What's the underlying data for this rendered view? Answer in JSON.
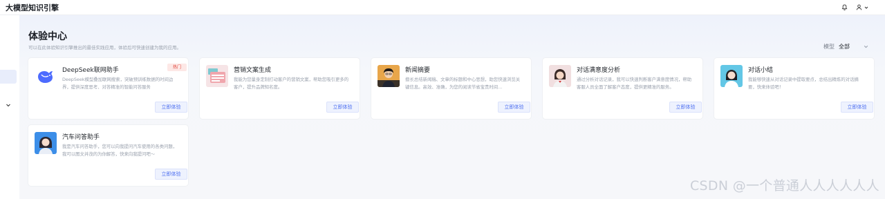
{
  "app": {
    "title": "大模型知识引擎"
  },
  "header": {
    "icons": [
      "bell-icon",
      "user-icon",
      "chevron-down-icon"
    ]
  },
  "page": {
    "title": "体验中心",
    "subtitle": "可以在此体验知识引擎推出的最佳实践应用，体验后可快速创建为我的应用。"
  },
  "filter": {
    "label": "模型",
    "value": "全部"
  },
  "cards": [
    {
      "name": "DeepSeek联网助手",
      "desc": "DeepSeek模型叠加联网搜索，突破预训练数据的时间边界，提供深度思考、对答精准的智能问答服务",
      "badge": "热门",
      "button": "立即体验",
      "icon": "deepseek-whale-icon"
    },
    {
      "name": "营销文案生成",
      "desc": "我能为您量身定制打动客户的营销文案，帮助您吸引更多的客户，提升品牌知名度。",
      "button": "立即体验",
      "icon": "typewriter-icon"
    },
    {
      "name": "新闻摘要",
      "desc": "擅长总结新闻稿、文章的标题和中心思想，助您快速浏览关键信息。高效、准确，为您的阅读节省宝贵时间...",
      "button": "立即体验",
      "icon": "news-reader-avatar"
    },
    {
      "name": "对话满意度分析",
      "desc": "通过分析对话记录，我可以快速判断客户满意度情况，帮助客服人员全面了解客户态度，提供更精准的服务。",
      "button": "立即体验",
      "icon": "service-agent-avatar"
    },
    {
      "name": "对话小结",
      "desc": "我能够快速从对话记录中提取要点，总结出精炼的对话摘要，快来体验吧！",
      "button": "立即体验",
      "icon": "headset-agent-avatar"
    },
    {
      "name": "汽车问答助手",
      "desc": "我是汽车问答助手，您可以向我提问汽车使用的各类问题，我可以图文并茂的为你解答，快来向我提问吧～",
      "button": "立即体验",
      "icon": "car-assistant-avatar"
    }
  ],
  "watermark": "CSDN @一个普通人人人人人人",
  "colors": {
    "accent": "#4c6ef0",
    "badge": "#e0453a",
    "background": "#f4f6fb"
  }
}
